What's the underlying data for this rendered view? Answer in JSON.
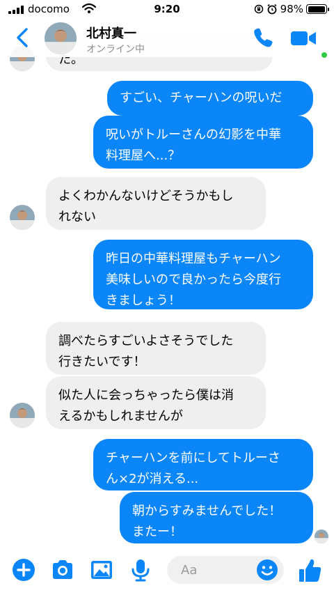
{
  "status_bar": {
    "carrier": "docomo",
    "time": "9:20",
    "battery": "98%",
    "battery_level": 0.98
  },
  "header": {
    "back_icon": "chevron-left-icon",
    "contact_name": "北村真一",
    "contact_status": "オンライン中"
  },
  "colors": {
    "accent": "#0a86f9",
    "incoming_bubble": "#efefef",
    "online": "#31cc46"
  },
  "messages": [
    {
      "dir": "in",
      "text": "た。"
    },
    {
      "dir": "out",
      "text": "すごい、チャーハンの呪いだ"
    },
    {
      "dir": "out",
      "lines": [
        "呪いがトルーさんの幻影を中華",
        "料理屋へ...？"
      ]
    },
    {
      "dir": "in",
      "lines": [
        "よくわかんないけどそうかもし",
        "れない"
      ]
    },
    {
      "dir": "out",
      "lines": [
        "昨日の中華料理屋もチャーハン",
        "美味しいので良かったら今度行",
        "きましょう！"
      ]
    },
    {
      "dir": "in",
      "lines": [
        "調べたらすごいよさそうでした",
        "行きたいです！"
      ]
    },
    {
      "dir": "in",
      "lines": [
        "似た人に会っちゃったら僕は消",
        "えるかもしれませんが"
      ]
    },
    {
      "dir": "out",
      "lines": [
        "チャーハンを前にしてトルーさ",
        "ん×2が消える..."
      ]
    },
    {
      "dir": "out",
      "lines": [
        "朝からすみませんでした！",
        "またー！"
      ]
    }
  ],
  "composer": {
    "placeholder": "Aa",
    "icons": [
      "plus-icon",
      "camera-icon",
      "image-icon",
      "microphone-icon",
      "emoji-icon",
      "thumbs-up-icon"
    ]
  }
}
